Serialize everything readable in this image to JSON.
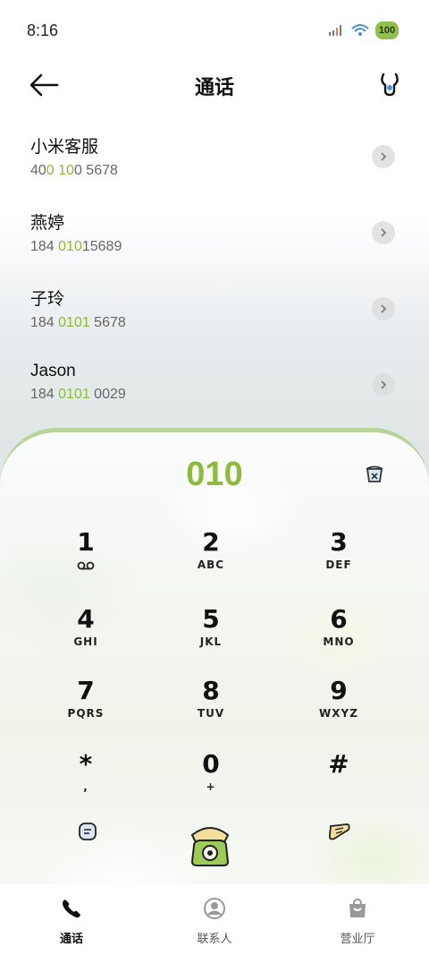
{
  "status": {
    "time": "8:16",
    "battery": "100"
  },
  "header": {
    "title": "通话"
  },
  "contacts": [
    {
      "name": "小米客服",
      "num_a": "40",
      "num_b": "0",
      "num_c": " ",
      "num_d": "10",
      "num_e": "0 5678"
    },
    {
      "name": "燕婷",
      "num_a": "184 ",
      "num_b": "010",
      "num_c": "",
      "num_d": "",
      "num_e": "15689"
    },
    {
      "name": "子玲",
      "num_a": "184 ",
      "num_b": "0101",
      "num_c": "",
      "num_d": "",
      "num_e": " 5678"
    },
    {
      "name": "Jason",
      "num_a": "184 ",
      "num_b": "0101",
      "num_c": "",
      "num_d": "",
      "num_e": " 0029"
    }
  ],
  "dialer": {
    "dialed": "010",
    "keys": [
      {
        "digit": "1",
        "letters": ""
      },
      {
        "digit": "2",
        "letters": "ABC"
      },
      {
        "digit": "3",
        "letters": "DEF"
      },
      {
        "digit": "4",
        "letters": "GHI"
      },
      {
        "digit": "5",
        "letters": "JKL"
      },
      {
        "digit": "6",
        "letters": "MNO"
      },
      {
        "digit": "7",
        "letters": "PQRS"
      },
      {
        "digit": "8",
        "letters": "TUV"
      },
      {
        "digit": "9",
        "letters": "WXYZ"
      },
      {
        "digit": "*",
        "letters": ","
      },
      {
        "digit": "0",
        "letters": "+"
      },
      {
        "digit": "#",
        "letters": ""
      }
    ]
  },
  "nav": {
    "calls": "通话",
    "contacts": "联系人",
    "store": "营业厅"
  },
  "colors": {
    "accent": "#8cbb3e",
    "text": "#111111"
  }
}
